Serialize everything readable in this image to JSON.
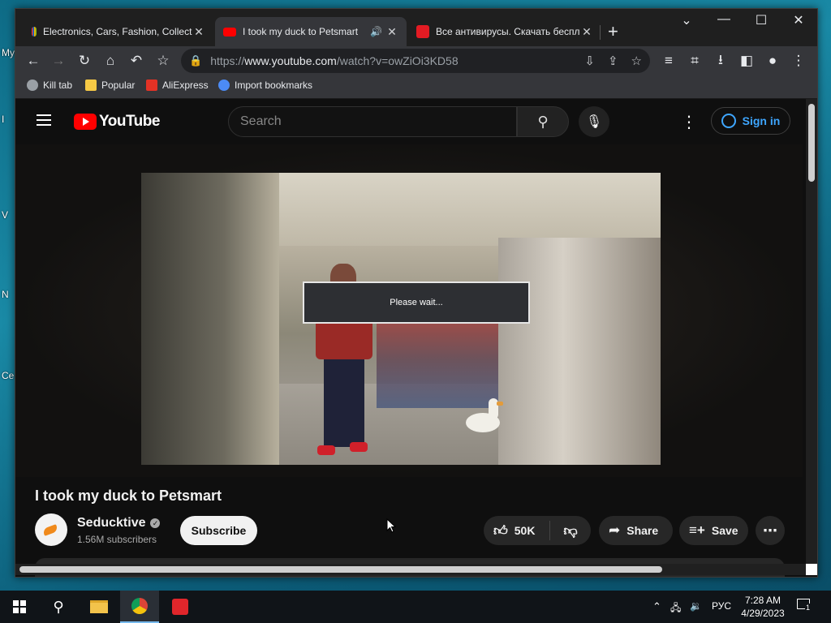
{
  "desktop": {
    "labels": [
      "My",
      "I",
      "V",
      "N",
      "Ce"
    ]
  },
  "browser": {
    "tabs": [
      {
        "title": "Electronics, Cars, Fashion, Collect",
        "favicon_color": "#86b817",
        "active": false
      },
      {
        "title": "I took my duck to Petsmart",
        "favicon_color": "#ff0000",
        "active": true,
        "audio_icon": "speaker-icon"
      },
      {
        "title": "Все антивирусы. Скачать беспл",
        "favicon_color": "#e31b23",
        "active": false
      }
    ],
    "new_tab": "+",
    "window_controls": {
      "minimize": "—",
      "maximize": "☐",
      "close": "✕",
      "tab_search": "⌄"
    },
    "address": {
      "scheme": "https://",
      "host": "www.youtube.com",
      "path": "/watch?v=owZiOi3KD58"
    },
    "bookmarks": [
      {
        "label": "Kill tab",
        "icon": "globe-icon",
        "color": "#9aa0a6"
      },
      {
        "label": "Popular",
        "icon": "folder-icon",
        "color": "#f6c945"
      },
      {
        "label": "AliExpress",
        "icon": "aliexpress-icon",
        "color": "#e43225"
      },
      {
        "label": "Import bookmarks",
        "icon": "gear-icon",
        "color": "#4c8bf5"
      }
    ]
  },
  "youtube": {
    "logo_text": "YouTube",
    "search_placeholder": "Search",
    "sign_in": "Sign in",
    "video": {
      "overlay_text": "Please wait...",
      "title": "I took my duck to Petsmart"
    },
    "channel": {
      "name": "Seducktive",
      "subscribers": "1.56M subscribers",
      "subscribe_label": "Subscribe"
    },
    "actions": {
      "likes": "50K",
      "share": "Share",
      "save": "Save"
    }
  },
  "taskbar": {
    "language": "РУС",
    "time": "7:28 AM",
    "date": "4/29/2023",
    "notification_count": "1"
  },
  "colors": {
    "accent": "#3ea6ff",
    "brand_red": "#ff0000",
    "taskbar": "#101418"
  }
}
